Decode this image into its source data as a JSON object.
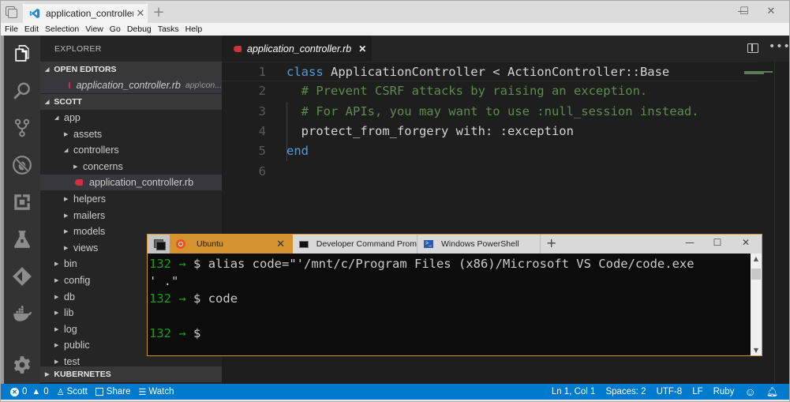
{
  "window": {
    "tab_title": "application_controller.r",
    "tab_close": "✕",
    "new_tab": "+",
    "minimize": "—",
    "maximize": "☐",
    "close": "✕"
  },
  "menu": [
    "File",
    "Edit",
    "Selection",
    "View",
    "Go",
    "Debug",
    "Tasks",
    "Help"
  ],
  "activity_bar": [
    "files-icon",
    "search-icon",
    "source-control-icon",
    "debug-icon",
    "extensions-icon",
    "test-flask-icon",
    "git-lens-icon",
    "docker-icon",
    "settings-gear-icon"
  ],
  "sidebar": {
    "title": "EXPLORER",
    "open_editors_label": "OPEN EDITORS",
    "open_editors": [
      {
        "name": "application_controller.rb",
        "path": "app\\con..."
      }
    ],
    "folder_label": "SCOTT",
    "tree": [
      {
        "label": "app",
        "expanded": true,
        "depth": 1
      },
      {
        "label": "assets",
        "expanded": false,
        "depth": 2
      },
      {
        "label": "controllers",
        "expanded": true,
        "depth": 2
      },
      {
        "label": "concerns",
        "expanded": false,
        "depth": 3
      },
      {
        "label": "application_controller.rb",
        "file": true,
        "depth": 3,
        "selected": true
      },
      {
        "label": "helpers",
        "expanded": false,
        "depth": 2
      },
      {
        "label": "mailers",
        "expanded": false,
        "depth": 2
      },
      {
        "label": "models",
        "expanded": false,
        "depth": 2
      },
      {
        "label": "views",
        "expanded": false,
        "depth": 2
      },
      {
        "label": "bin",
        "expanded": false,
        "depth": 1
      },
      {
        "label": "config",
        "expanded": false,
        "depth": 1
      },
      {
        "label": "db",
        "expanded": false,
        "depth": 1
      },
      {
        "label": "lib",
        "expanded": false,
        "depth": 1
      },
      {
        "label": "log",
        "expanded": false,
        "depth": 1
      },
      {
        "label": "public",
        "expanded": false,
        "depth": 1
      },
      {
        "label": "test",
        "expanded": false,
        "depth": 1
      }
    ],
    "kubernetes_label": "KUBERNETES"
  },
  "editor": {
    "tab_label": "application_controller.rb",
    "tab_close": "✕",
    "more": "•••",
    "lines": [
      {
        "n": "1",
        "tokens": [
          {
            "t": "class",
            "c": "kw"
          },
          {
            "t": " ApplicationController < ActionController::Base",
            "c": "pl"
          }
        ]
      },
      {
        "n": "2",
        "tokens": [
          {
            "t": "  # Prevent CSRF attacks by raising an exception.",
            "c": "cm"
          }
        ]
      },
      {
        "n": "3",
        "tokens": [
          {
            "t": "  # For APIs, you may want to use :null_session instead.",
            "c": "cm"
          }
        ]
      },
      {
        "n": "4",
        "tokens": [
          {
            "t": "  protect_from_forgery with: :exception",
            "c": "pl"
          }
        ]
      },
      {
        "n": "5",
        "tokens": [
          {
            "t": "end",
            "c": "kw"
          }
        ]
      },
      {
        "n": "6",
        "tokens": []
      }
    ]
  },
  "terminal": {
    "tabs": [
      {
        "label": "Ubuntu",
        "icon": "ubuntu-icon",
        "active": true
      },
      {
        "label": "Developer Command Prom",
        "icon": "cmd-icon",
        "active": false
      },
      {
        "label": "Windows PowerShell",
        "icon": "powershell-icon",
        "active": false
      }
    ],
    "close": "✕",
    "new_tab": "+",
    "minimize": "—",
    "maximize": "☐",
    "win_close": "✕",
    "lines": [
      {
        "num": "132",
        "arrow": "→",
        "cmd": "$ alias code=\"'/mnt/c/Program Files (x86)/Microsoft VS Code/code.exe"
      },
      {
        "cont": "' .\""
      },
      {
        "num": "132",
        "arrow": "→",
        "cmd": "$ code"
      },
      {
        "blank": true
      },
      {
        "num": "132",
        "arrow": "→",
        "cmd": "$"
      }
    ]
  },
  "statusbar": {
    "errors": "0",
    "warnings": "0",
    "user": "Scott",
    "share": "Share",
    "watch": "Watch",
    "position": "Ln 1, Col 1",
    "spaces": "Spaces: 2",
    "encoding": "UTF-8",
    "eol": "LF",
    "language": "Ruby"
  },
  "colors": {
    "accent": "#007acc",
    "terminal_tab_active": "#d4932f",
    "ruby": "#d2303f",
    "keyword": "#569cd6",
    "comment": "#608b4e",
    "prompt": "#13a10e"
  }
}
